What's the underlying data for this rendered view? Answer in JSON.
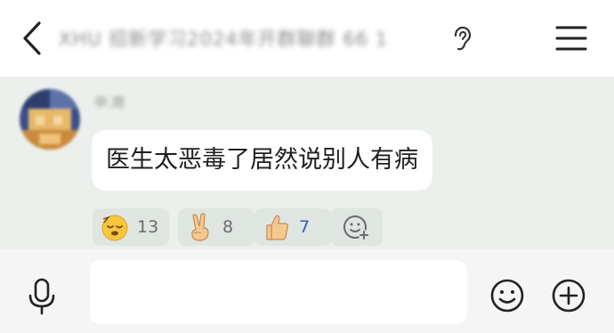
{
  "header": {
    "title": "XHU 招新学习2024年开群聊群 66 1",
    "icons": {
      "back": "chevron-left-icon",
      "voice_mode": "ear-icon",
      "menu": "hamburger-menu-icon"
    }
  },
  "message": {
    "sender_name": "申.靡",
    "text": "医生太恶毒了居然说别人有病",
    "reactions": [
      {
        "emoji": "sleepy-face-icon",
        "count": "13"
      },
      {
        "emoji": "peace-hand-icon",
        "count": "8"
      },
      {
        "emoji": "thumbs-up-icon",
        "count": "7"
      }
    ],
    "add_reaction_icon": "add-reaction-icon"
  },
  "input_bar": {
    "value": "",
    "placeholder": "",
    "icons": {
      "voice": "microphone-icon",
      "emoji": "smiley-icon",
      "more": "plus-circle-icon"
    }
  },
  "colors": {
    "background": "#ecf0ec",
    "header_bg": "#ffffff",
    "bubble_bg": "#ffffff",
    "reaction_bg": "#dfe5e0",
    "highlight_count": "#3a5bbf",
    "input_bar_bg": "#f4f5f4"
  }
}
